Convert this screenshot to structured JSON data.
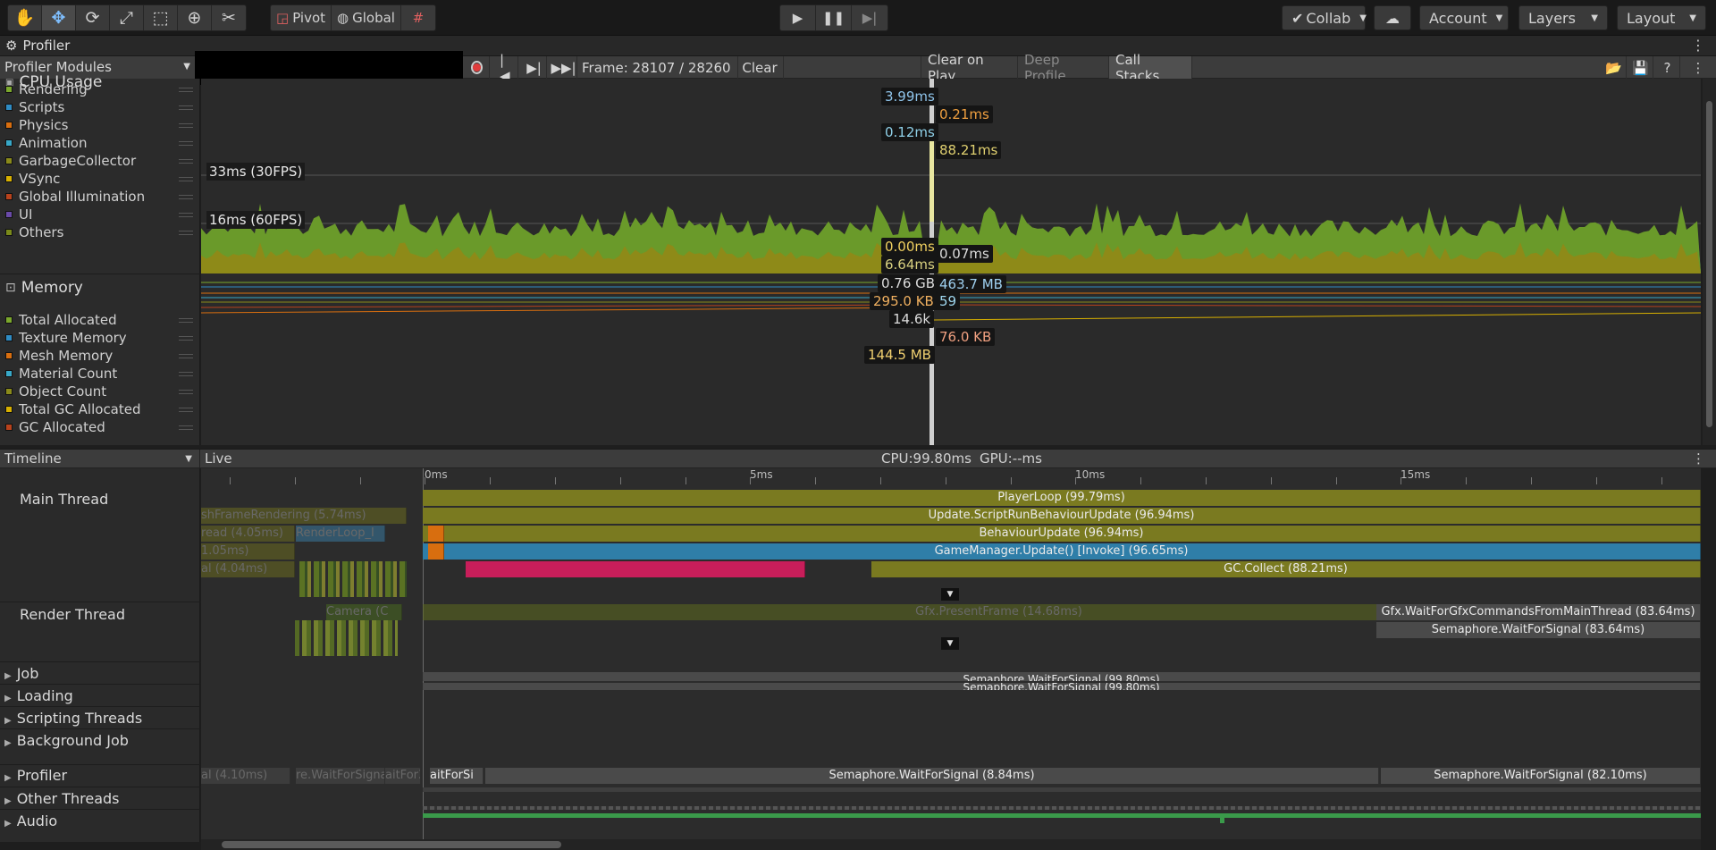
{
  "toolbar": {
    "pivot_label": "Pivot",
    "global_label": "Global",
    "collab_label": "Collab",
    "account_label": "Account",
    "layers_label": "Layers",
    "layout_label": "Layout"
  },
  "window": {
    "tab_title": "Profiler",
    "menu_glyph": "⋮"
  },
  "controls": {
    "modules_label": "Profiler Modules",
    "frame_label": "Frame: 28107 / 28260",
    "clear_label": "Clear",
    "clear_on_play_label": "Clear on Play",
    "deep_profile_label": "Deep Profile",
    "call_stacks_label": "Call Stacks"
  },
  "cpu_module": {
    "title": "CPU Usage",
    "legend": [
      {
        "label": "Rendering",
        "color": "#7ba82c"
      },
      {
        "label": "Scripts",
        "color": "#2f8cc4"
      },
      {
        "label": "Physics",
        "color": "#d86e0f"
      },
      {
        "label": "Animation",
        "color": "#38a8c8"
      },
      {
        "label": "GarbageCollector",
        "color": "#8a8a1a"
      },
      {
        "label": "VSync",
        "color": "#d8b000"
      },
      {
        "label": "Global Illumination",
        "color": "#b8421c"
      },
      {
        "label": "UI",
        "color": "#6a4aa8"
      },
      {
        "label": "Others",
        "color": "#7a8a1a"
      }
    ],
    "fps30_label": "33ms (30FPS)",
    "fps60_label": "16ms (60FPS)",
    "value_labels": {
      "v1": "3.99ms",
      "v2": "0.21ms",
      "v3": "0.12ms",
      "v4": "88.21ms",
      "v5": "0.00ms",
      "v6": "0.07ms",
      "v7": "6.64ms"
    }
  },
  "memory_module": {
    "title": "Memory",
    "legend": [
      {
        "label": "Total Allocated",
        "color": "#7ba82c"
      },
      {
        "label": "Texture Memory",
        "color": "#2f8cc4"
      },
      {
        "label": "Mesh Memory",
        "color": "#d86e0f"
      },
      {
        "label": "Material Count",
        "color": "#38a8c8"
      },
      {
        "label": "Object Count",
        "color": "#8a8a1a"
      },
      {
        "label": "Total GC Allocated",
        "color": "#d8b000"
      },
      {
        "label": "GC Allocated",
        "color": "#b8421c"
      }
    ],
    "value_labels": {
      "total_allocated": "0.76 GB",
      "texture": "463.7 MB",
      "mesh": "295.0 KB",
      "material_count": "59",
      "object_count": "14.6k",
      "gc_allocated": "76.0 KB",
      "total_gc": "144.5 MB"
    }
  },
  "timeline": {
    "view_label": "Timeline",
    "live_label": "Live",
    "cpu_label": "CPU:99.80ms",
    "gpu_label": "GPU:--ms",
    "ruler": [
      "0ms",
      "5ms",
      "10ms",
      "15ms"
    ],
    "threads": {
      "main": "Main Thread",
      "render": "Render Thread"
    },
    "groups": [
      "Job",
      "Loading",
      "Scripting Threads",
      "Background Job",
      "Profiler",
      "Other Threads",
      "Audio"
    ],
    "markers": {
      "player_loop": "PlayerLoop (99.79ms)",
      "script_run": "Update.ScriptRunBehaviourUpdate (96.94ms)",
      "behaviour_update": "BehaviourUpdate (96.94ms)",
      "game_manager": "GameManager.Update() [Invoke] (96.65ms)",
      "gc_collect": "GC.Collect (88.21ms)",
      "prev_finish_rendering": "shFrameRendering (5.74ms)",
      "prev_thread": "read (4.05ms)",
      "prev_renderloop": "RenderLoop_I",
      "prev_005": "1.05ms)",
      "prev_404": "al (4.04ms)",
      "camera": "Camera (C",
      "present_frame": "Gfx.PresentFrame (14.68ms)",
      "wait_gfx": "Gfx.WaitForGfxCommandsFromMainThread (83.64ms)",
      "render_semaphore": "Semaphore.WaitForSignal (83.64ms)",
      "loading_sem1": "Semaphore.WaitForSignal (99.80ms)",
      "loading_sem2": "Semaphore.WaitForSignal (99.80ms)",
      "prof_prev1": "al (4.10ms)",
      "prof_prev2": "re.WaitForSigna",
      "prof_prev3": "aitFor3",
      "prof_prev4": "aitForSi",
      "prof_sem1": "Semaphore.WaitForSignal (8.84ms)",
      "prof_sem2": "Semaphore.WaitForSignal (82.10ms)"
    }
  }
}
